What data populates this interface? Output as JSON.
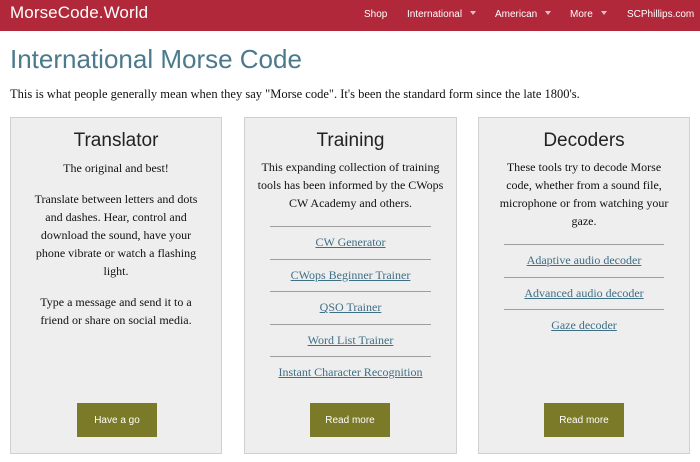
{
  "navbar": {
    "brand": "MorseCode.World",
    "items": [
      {
        "label": "Shop",
        "dropdown": false
      },
      {
        "label": "International",
        "dropdown": true
      },
      {
        "label": "American",
        "dropdown": true
      },
      {
        "label": "More",
        "dropdown": true
      },
      {
        "label": "SCPhillips.com",
        "dropdown": false
      }
    ]
  },
  "page": {
    "title": "International Morse Code",
    "intro": "This is what people generally mean when they say \"Morse code\". It's been the standard form since the late 1800's."
  },
  "cards": [
    {
      "title": "Translator",
      "paragraphs": [
        "The original and best!",
        "Translate between letters and dots and dashes. Hear, control and download the sound, have your phone vibrate or watch a flashing light.",
        "Type a message and send it to a friend or share on social media."
      ],
      "links": [],
      "button": "Have a go"
    },
    {
      "title": "Training",
      "paragraphs": [
        "This expanding collection of training tools has been informed by the CWops CW Academy and others."
      ],
      "links": [
        "CW Generator",
        "CWops Beginner Trainer",
        "QSO Trainer",
        "Word List Trainer",
        "Instant Character Recognition"
      ],
      "button": "Read more"
    },
    {
      "title": "Decoders",
      "paragraphs": [
        "These tools try to decode Morse code, whether from a sound file, microphone or from watching your gaze."
      ],
      "links": [
        "Adaptive audio decoder",
        "Advanced audio decoder",
        "Gaze decoder"
      ],
      "button": "Read more"
    }
  ],
  "colors": {
    "navbar": "#b0283a",
    "title": "#4a7a8c",
    "card_bg": "#eeeeee",
    "button": "#7a7a28",
    "link": "#3f6f86"
  }
}
